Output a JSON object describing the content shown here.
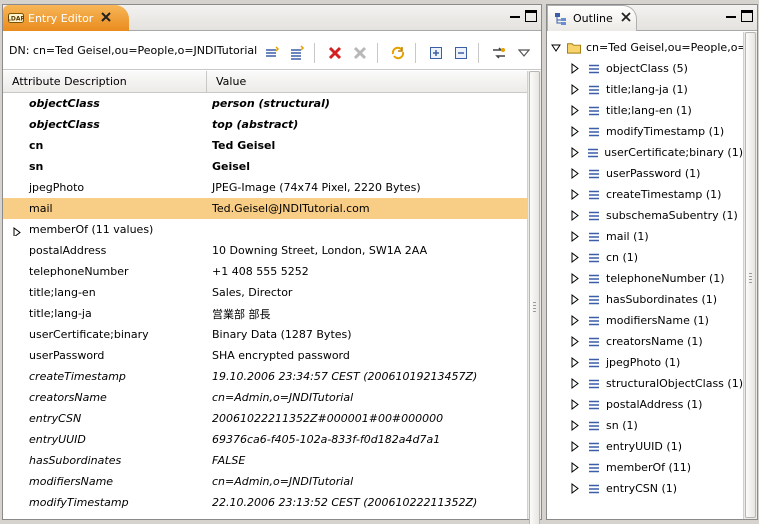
{
  "editor": {
    "tab_title": "Entry Editor",
    "dn": "DN: cn=Ted Geisel,ou=People,o=JNDITutorial",
    "columns": [
      "Attribute Description",
      "Value"
    ],
    "rows": [
      {
        "attr": "objectClass",
        "value": "person (structural)",
        "style": "bolditalic"
      },
      {
        "attr": "objectClass",
        "value": "top (abstract)",
        "style": "bolditalic"
      },
      {
        "attr": "cn",
        "value": "Ted Geisel",
        "style": "bold"
      },
      {
        "attr": "sn",
        "value": "Geisel",
        "style": "bold"
      },
      {
        "attr": "jpegPhoto",
        "value": "JPEG-Image (74x74 Pixel, 2220 Bytes)",
        "style": "normal"
      },
      {
        "attr": "mail",
        "value": "Ted.Geisel@JNDITutorial.com",
        "style": "normal",
        "selected": true
      },
      {
        "attr": "memberOf (11 values)",
        "value": "",
        "style": "normal",
        "expandable": true
      },
      {
        "attr": "postalAddress",
        "value": "10 Downing Street, London, SW1A 2AA",
        "style": "normal"
      },
      {
        "attr": "telephoneNumber",
        "value": "+1 408 555 5252",
        "style": "normal"
      },
      {
        "attr": "title;lang-en",
        "value": "Sales, Director",
        "style": "normal"
      },
      {
        "attr": "title;lang-ja",
        "value": "営業部 部長",
        "style": "normal"
      },
      {
        "attr": "userCertificate;binary",
        "value": "Binary Data (1287 Bytes)",
        "style": "normal"
      },
      {
        "attr": "userPassword",
        "value": "SHA encrypted password",
        "style": "normal"
      },
      {
        "attr": "createTimestamp",
        "value": "19.10.2006 23:34:57 CEST (20061019213457Z)",
        "style": "italic"
      },
      {
        "attr": "creatorsName",
        "value": "cn=Admin,o=JNDITutorial",
        "style": "italic"
      },
      {
        "attr": "entryCSN",
        "value": "20061022211352Z#000001#00#000000",
        "style": "italic"
      },
      {
        "attr": "entryUUID",
        "value": "69376ca6-f405-102a-833f-f0d182a4d7a1",
        "style": "italic"
      },
      {
        "attr": "hasSubordinates",
        "value": "FALSE",
        "style": "italic"
      },
      {
        "attr": "modifiersName",
        "value": "cn=Admin,o=JNDITutorial",
        "style": "italic"
      },
      {
        "attr": "modifyTimestamp",
        "value": "22.10.2006 23:13:52 CEST (20061022211352Z)",
        "style": "italic"
      }
    ],
    "toolbar_icons": [
      "new-value-icon",
      "new-attribute-icon",
      "delete-icon",
      "delete-all-icon",
      "refresh-icon",
      "expand-all-icon",
      "collapse-all-icon",
      "show-decorated-icon",
      "view-menu-icon"
    ]
  },
  "outline": {
    "tab_title": "Outline",
    "root": "cn=Ted Geisel,ou=People,o=JNDITutorial",
    "items": [
      "objectClass (5)",
      "title;lang-ja (1)",
      "title;lang-en (1)",
      "modifyTimestamp (1)",
      "userCertificate;binary (1)",
      "userPassword (1)",
      "createTimestamp (1)",
      "subschemaSubentry (1)",
      "mail (1)",
      "cn (1)",
      "telephoneNumber (1)",
      "hasSubordinates (1)",
      "modifiersName (1)",
      "creatorsName (1)",
      "jpegPhoto (1)",
      "structuralObjectClass (1)",
      "postalAddress (1)",
      "sn (1)",
      "entryUUID (1)",
      "memberOf (11)",
      "entryCSN (1)"
    ]
  },
  "colors": {
    "active_tab": "#e98c1e",
    "selection": "#f8cd86"
  }
}
